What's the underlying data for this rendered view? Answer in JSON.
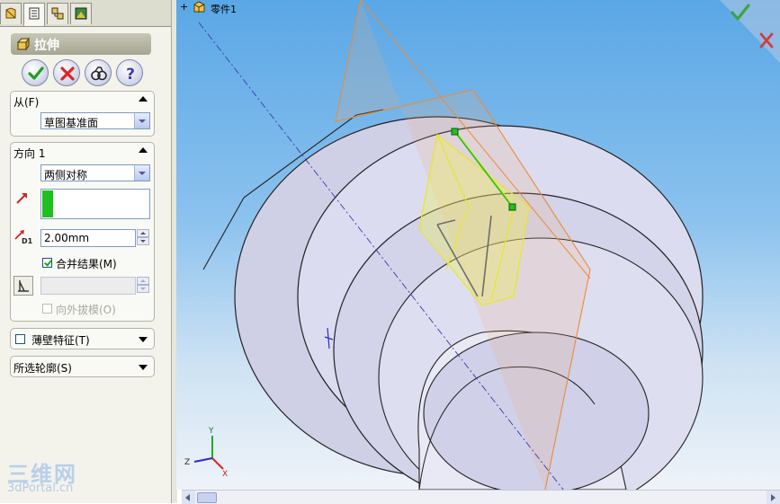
{
  "feature": {
    "title": "拉伸",
    "icon": "extrude-icon"
  },
  "tabs": [
    {
      "icon": "feature-manager-icon"
    },
    {
      "icon": "property-manager-icon"
    },
    {
      "icon": "configuration-manager-icon"
    },
    {
      "icon": "display-manager-icon"
    }
  ],
  "actions": [
    {
      "icon": "ok-check-icon"
    },
    {
      "icon": "cancel-x-icon"
    },
    {
      "icon": "detailed-preview-icon"
    },
    {
      "icon": "help-icon"
    }
  ],
  "from_group": {
    "label": "从(F)",
    "value": "草图基准面"
  },
  "direction_group": {
    "label": "方向 1",
    "end_condition": "两侧对称",
    "depth": "2.00mm",
    "merge_label": "合并结果(M)",
    "merge_checked": true,
    "draft_outward_label": "向外拔模(O)",
    "draft_outward_checked": false
  },
  "thin_feature": {
    "label": "薄壁特征(T)",
    "checked": false
  },
  "selected_contours": {
    "label": "所选轮廓(S)"
  },
  "tree": {
    "expand": "+",
    "part_label": "零件1"
  },
  "confirm_corner": {
    "ok_color": "#3aa63a",
    "cancel_color": "#d33d3d"
  },
  "watermark": {
    "top": "三维网",
    "bottom": "3dPortal.cn"
  },
  "colors": {
    "accent": "#21c021",
    "preview": "#f0f04a",
    "plane": "#e98c3a",
    "model": "#d9d9ee"
  }
}
